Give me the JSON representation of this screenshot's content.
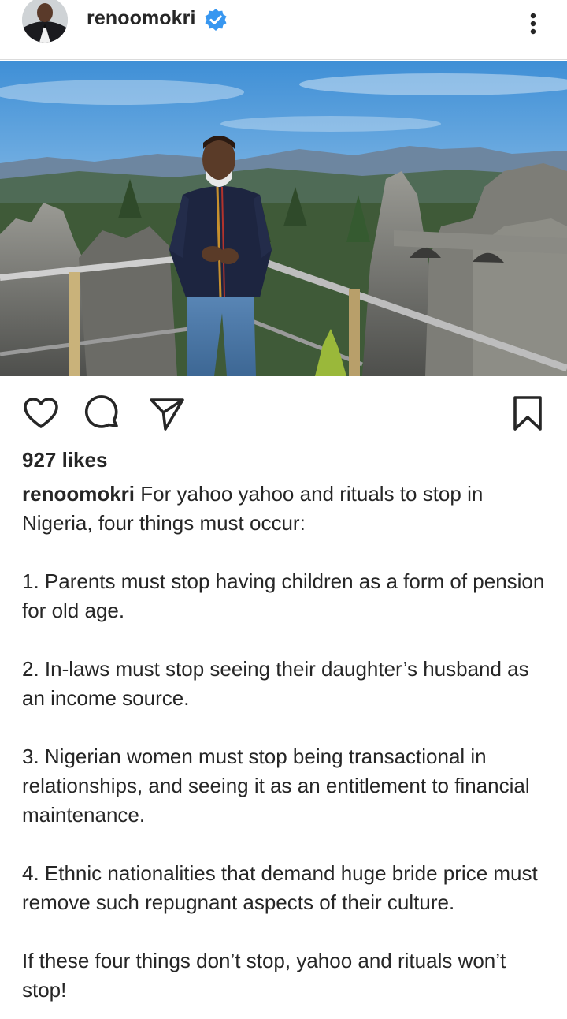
{
  "post": {
    "username": "renoomokri",
    "likes": "927 likes",
    "caption": {
      "author": "renoomokri",
      "intro": "For yahoo yahoo and rituals to stop in Nigeria, four things must occur:",
      "points": [
        "1. Parents must stop having children as a form of pension for old age.",
        "2. In-laws must stop seeing their daughter’s husband as an income source.",
        "3. Nigerian women must stop being transactional in relationships, and seeing it as an entitlement to financial maintenance.",
        "4. Ethnic nationalities that demand huge bride price must remove such repugnant aspects of their culture."
      ],
      "closing": "If these four things don’t stop, yahoo and rituals won’t stop!"
    }
  },
  "icons": {
    "verified": "verified-badge-icon",
    "more": "more-options-icon",
    "like": "heart-icon",
    "comment": "comment-icon",
    "share": "share-icon",
    "save": "bookmark-icon"
  },
  "colors": {
    "text": "#262626",
    "verified": "#3897f0",
    "divider": "#dbdbdb"
  }
}
